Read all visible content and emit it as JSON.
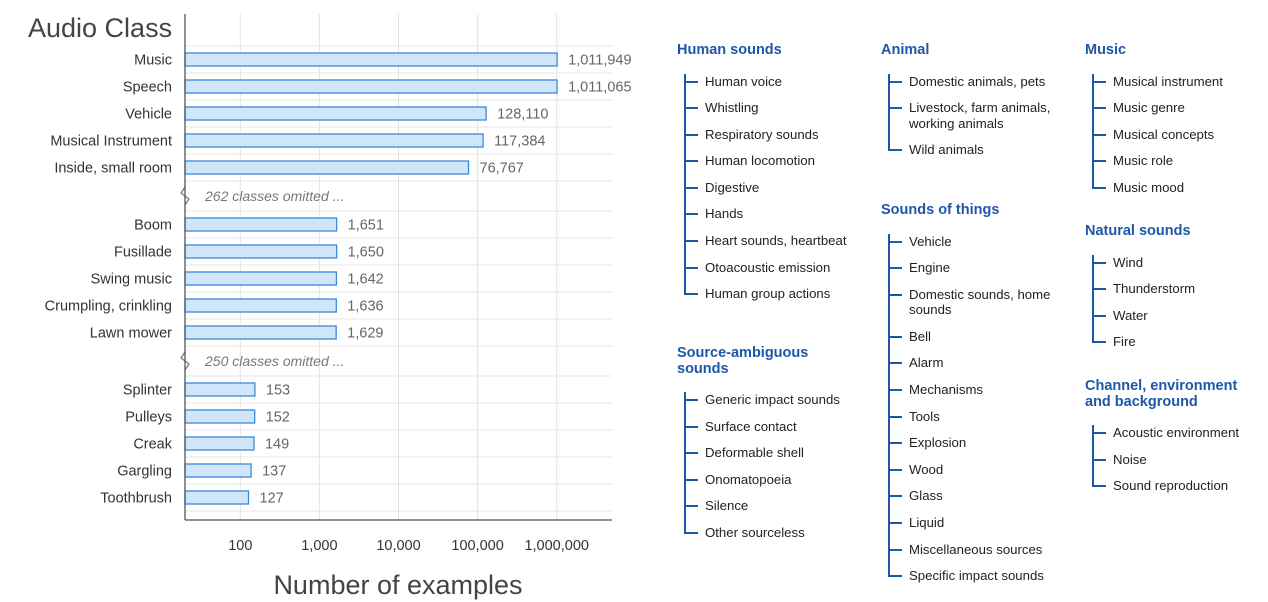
{
  "chart_data": {
    "type": "bar",
    "title": "Audio Class",
    "xlabel": "Number of examples",
    "xscale": "log",
    "xlim": [
      20,
      5000000
    ],
    "xticks": [
      "100",
      "1,000",
      "10,000",
      "100,000",
      "1,000,000"
    ],
    "xtick_values": [
      100,
      1000,
      10000,
      100000,
      1000000
    ],
    "bar_color": "#cfe6fa",
    "bar_edge_color": "#3c8ad6",
    "groups": [
      {
        "categories": [
          "Music",
          "Speech",
          "Vehicle",
          "Musical Instrument",
          "Inside, small room"
        ],
        "values": [
          1011949,
          1011065,
          128110,
          117384,
          76767
        ],
        "labels": [
          "1,011,949",
          "1,011,065",
          "128,110",
          "117,384",
          "76,767"
        ]
      },
      {
        "categories": [
          "Boom",
          "Fusillade",
          "Swing music",
          "Crumpling, crinkling",
          "Lawn mower"
        ],
        "values": [
          1651,
          1650,
          1642,
          1636,
          1629
        ],
        "labels": [
          "1,651",
          "1,650",
          "1,642",
          "1,636",
          "1,629"
        ]
      },
      {
        "categories": [
          "Splinter",
          "Pulleys",
          "Creak",
          "Gargling",
          "Toothbrush"
        ],
        "values": [
          153,
          152,
          149,
          137,
          127
        ],
        "labels": [
          "153",
          "152",
          "149",
          "137",
          "127"
        ]
      }
    ],
    "omitted_notes": [
      "262 classes omitted ...",
      "250 classes omitted ..."
    ],
    "grid": true
  },
  "ontology": {
    "accent_color": "#1f57a8",
    "columns": [
      [
        {
          "title": "Human sounds",
          "items": [
            "Human voice",
            "Whistling",
            "Respiratory sounds",
            "Human locomotion",
            "Digestive",
            "Hands",
            "Heart sounds, heartbeat",
            "Otoacoustic emission",
            "Human group actions"
          ]
        },
        {
          "title": "Source-ambiguous sounds",
          "items": [
            "Generic impact sounds",
            "Surface contact",
            "Deformable shell",
            "Onomatopoeia",
            "Silence",
            "Other sourceless"
          ]
        }
      ],
      [
        {
          "title": "Animal",
          "items": [
            "Domestic animals, pets",
            "Livestock, farm animals, working animals",
            "Wild animals"
          ]
        },
        {
          "title": "Sounds of things",
          "items": [
            "Vehicle",
            "Engine",
            "Domestic sounds, home sounds",
            "Bell",
            "Alarm",
            "Mechanisms",
            "Tools",
            "Explosion",
            "Wood",
            "Glass",
            "Liquid",
            "Miscellaneous sources",
            "Specific impact sounds"
          ]
        }
      ],
      [
        {
          "title": "Music",
          "items": [
            "Musical instrument",
            "Music genre",
            "Musical concepts",
            "Music role",
            "Music mood"
          ]
        },
        {
          "title": "Natural sounds",
          "items": [
            "Wind",
            "Thunderstorm",
            "Water",
            "Fire"
          ]
        },
        {
          "title": "Channel, environment and background",
          "items": [
            "Acoustic environment",
            "Noise",
            "Sound reproduction"
          ]
        }
      ]
    ]
  }
}
